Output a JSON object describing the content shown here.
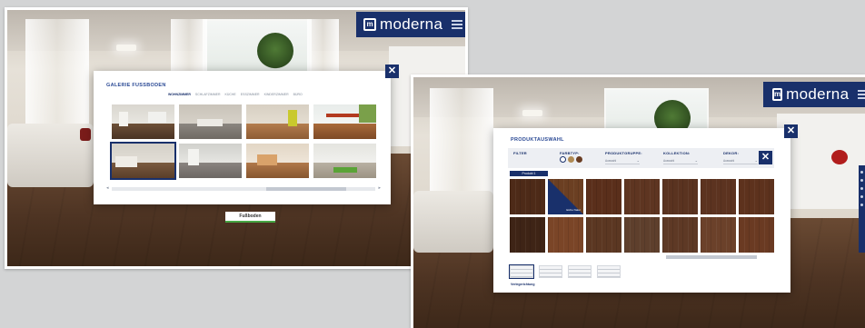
{
  "screen1": {
    "brand": {
      "logo_mark": "m",
      "name": "moderna",
      "menu_icon": "hamburger-menu-icon"
    },
    "gallery_dialog": {
      "title": "GALERIE FUSSBODEN",
      "tabs": [
        "WOHNZIMMER",
        "SCHLAFZIMMER",
        "KÜCHE",
        "ESSZIMMER",
        "KINDERZIMMER",
        "BÜRO"
      ],
      "active_tab_index": 0,
      "close_label": "✕",
      "thumbnails": [
        {
          "name": "living-room-1",
          "selected": false
        },
        {
          "name": "living-room-2",
          "selected": false
        },
        {
          "name": "living-room-3",
          "selected": false
        },
        {
          "name": "dining-room",
          "selected": false
        },
        {
          "name": "living-room-4",
          "selected": true
        },
        {
          "name": "living-room-5",
          "selected": false
        },
        {
          "name": "living-room-6",
          "selected": false
        },
        {
          "name": "living-room-7",
          "selected": false
        }
      ]
    },
    "floor_button_label": "Fußboden"
  },
  "screen2": {
    "brand": {
      "logo_mark": "m",
      "name": "moderna",
      "menu_icon": "hamburger-menu-icon"
    },
    "product_dialog": {
      "title": "PRODUKTAUSWAHL",
      "close_label": "✕",
      "filters": {
        "filter_label": "FILTER",
        "farbtyp_label": "FARBTYP:",
        "produktgruppe_label": "PRODUKTGRUPPE:",
        "kollektion_label": "KOLLEKTION:",
        "dekor_label": "DEKOR:",
        "select_placeholder": "Auswahl",
        "reset_label": "✕",
        "swatch_colors": [
          "#ffffff",
          "#b08b54",
          "#6a3d22"
        ]
      },
      "product_tag": "Produkt 1",
      "selected_label": "Eiche Natur",
      "woods": [
        "#4d2a18",
        "#6b3f22",
        "#5a2f1b",
        "#5e3521",
        "#5a3320",
        "#5c3320",
        "#5d321d",
        "#3e2416",
        "#7a4527",
        "#5b3722",
        "#5e3f2c",
        "#5e3925",
        "#6b412a",
        "#6a3a22"
      ],
      "selected_wood_index": 1,
      "layouts": [
        "layout-plank",
        "layout-wide",
        "layout-herringbone",
        "layout-tile"
      ],
      "selected_layout_index": 0,
      "verlegerichtung_label": "Verlegerichtung"
    }
  }
}
